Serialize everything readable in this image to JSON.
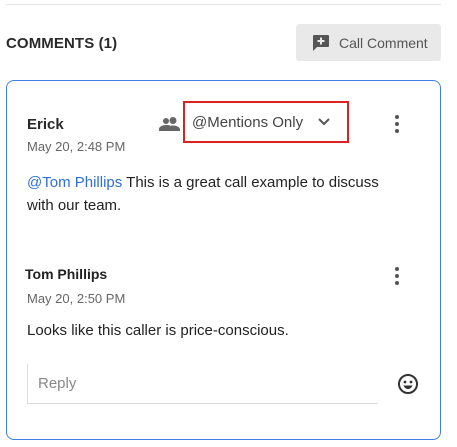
{
  "header": {
    "title": "COMMENTS (1)",
    "call_comment_label": "Call Comment",
    "call_comment_icon": "add-comment-icon"
  },
  "comment": {
    "author": "Erick",
    "timestamp": "May 20, 2:48 PM",
    "visibility": "@Mentions Only",
    "mention": "@Tom Phillips",
    "text": " This is a great call example to discuss with our team."
  },
  "reply": {
    "author": "Tom Phillips",
    "timestamp": "May 20, 2:50 PM",
    "text": "Looks like this caller is price-conscious."
  },
  "reply_input": {
    "placeholder": "Reply"
  },
  "colors": {
    "accent": "#3f7fe0",
    "mention": "#2f6fd6",
    "highlight": "#e02020"
  }
}
